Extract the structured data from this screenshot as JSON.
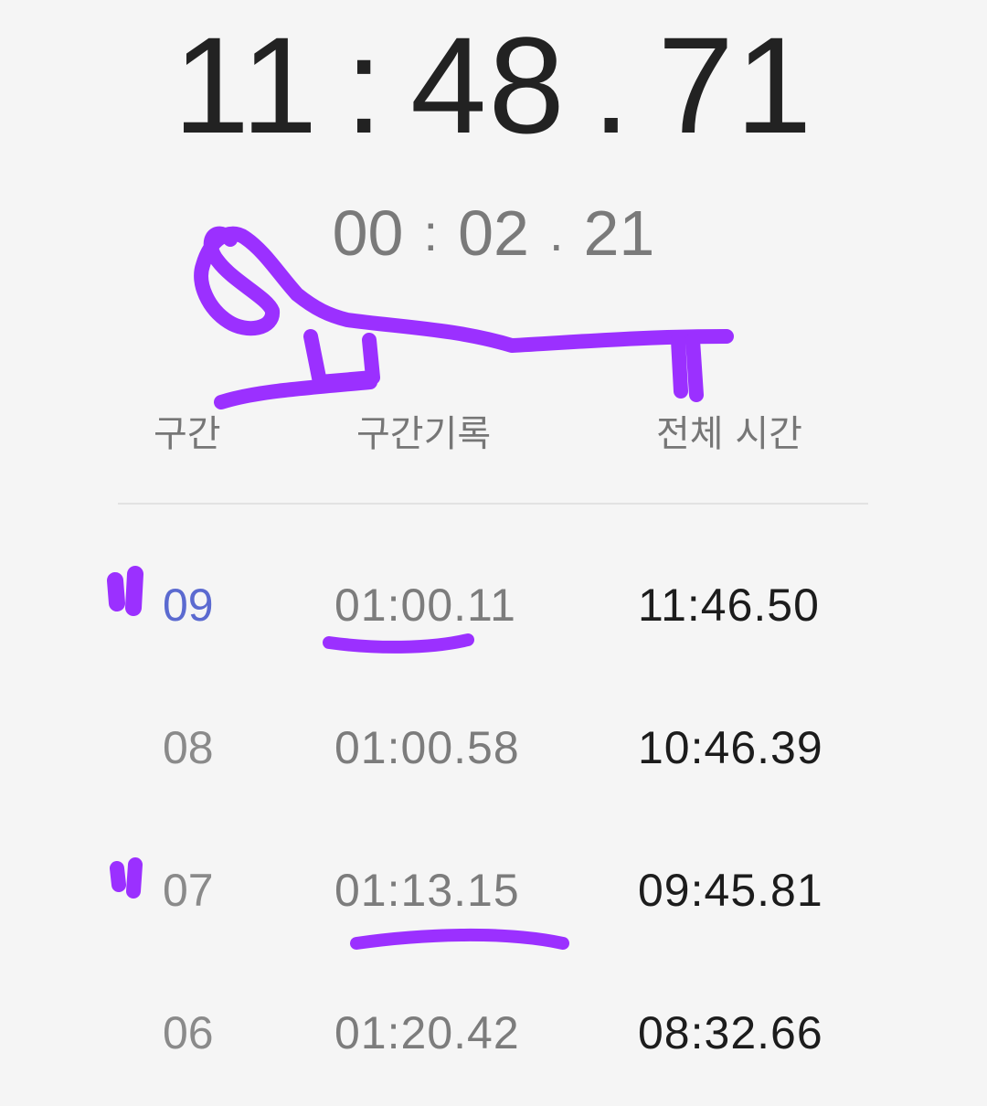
{
  "stopwatch": {
    "main": {
      "minutes": "11",
      "seconds": "48",
      "centis": "71",
      "colon": ":",
      "dot": "."
    },
    "lap": {
      "minutes": "00",
      "seconds": "02",
      "centis": "21",
      "colon": ":",
      "dot": "."
    }
  },
  "table": {
    "headers": {
      "lap": "구간",
      "lap_time": "구간기록",
      "total_time": "전체 시간"
    },
    "rows": [
      {
        "num": "09",
        "lap_time": "01:00.11",
        "total": "11:46.50",
        "active": true
      },
      {
        "num": "08",
        "lap_time": "01:00.58",
        "total": "10:46.39",
        "active": false
      },
      {
        "num": "07",
        "lap_time": "01:13.15",
        "total": "09:45.81",
        "active": false
      },
      {
        "num": "06",
        "lap_time": "01:20.42",
        "total": "08:32.66",
        "active": false
      }
    ]
  },
  "colors": {
    "background": "#f5f5f5",
    "annotation": "#9b30ff",
    "active_lap": "#5b6ad0"
  }
}
